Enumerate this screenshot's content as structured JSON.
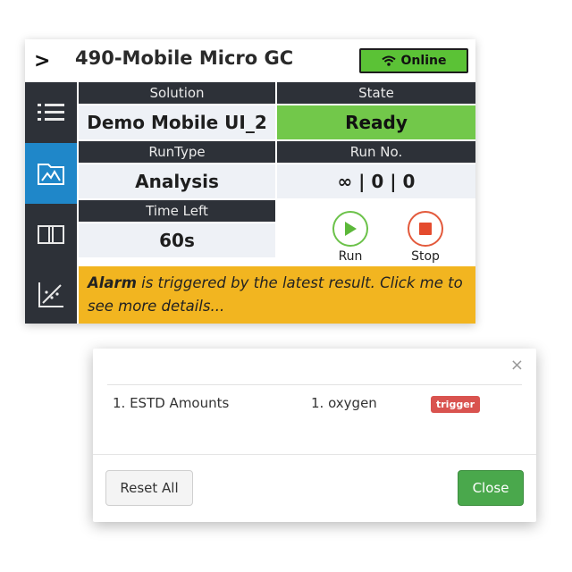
{
  "header": {
    "title": "490-Mobile Micro GC",
    "status_label": "Online",
    "status_color": "#5bc236"
  },
  "sidebar": {
    "items": [
      {
        "icon": "list-icon",
        "active": false
      },
      {
        "icon": "chromatogram-icon",
        "active": true
      },
      {
        "icon": "book-icon",
        "active": false
      },
      {
        "icon": "scatter-chart-icon",
        "active": false
      }
    ]
  },
  "grid": {
    "solution_header": "Solution",
    "solution_value": "Demo Mobile UI_2",
    "state_header": "State",
    "state_value": "Ready",
    "runtype_header": "RunType",
    "runtype_value": "Analysis",
    "runno_header": "Run No.",
    "runno_value": "∞ | 0 | 0",
    "timeleft_header": "Time Left",
    "timeleft_value": "60s"
  },
  "controls": {
    "run_label": "Run",
    "stop_label": "Stop"
  },
  "alarm": {
    "bold": "Alarm",
    "text": " is triggered by the latest result. Click me to see more details..."
  },
  "modal": {
    "close_glyph": "×",
    "row": {
      "method": "1. ESTD Amounts",
      "compound": "1. oxygen",
      "badge": "trigger"
    },
    "reset_label": "Reset All",
    "close_label": "Close"
  },
  "colors": {
    "sidebar_bg": "#2d3138",
    "active_nav": "#1f87c9",
    "ready_green": "#72c84a",
    "alarm_yellow": "#f2b520",
    "badge_red": "#d9534f",
    "close_green": "#4aa84c"
  }
}
